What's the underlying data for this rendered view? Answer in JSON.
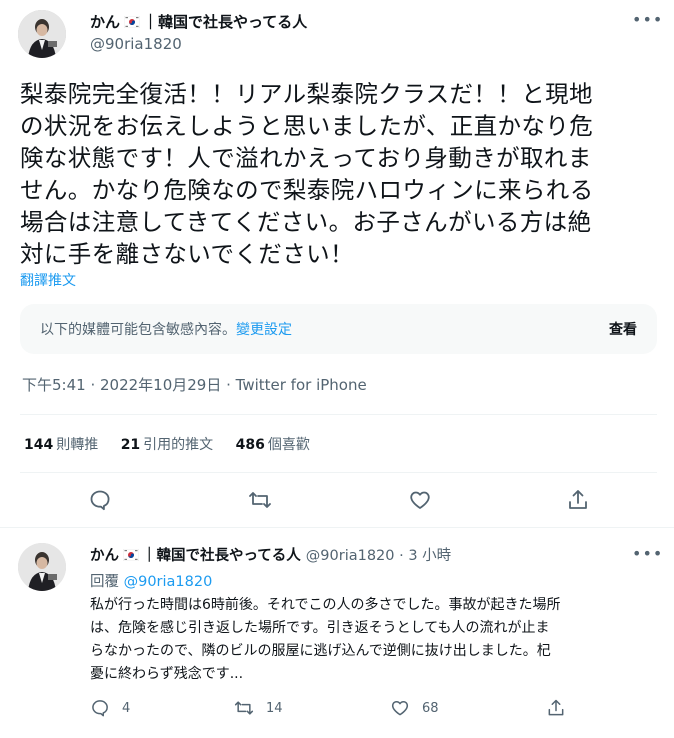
{
  "colors": {
    "accent": "#1d9bf0",
    "text": "#0f1419",
    "muted": "#536471",
    "box": "#f7f9f9",
    "border": "#eff3f4"
  },
  "main": {
    "display_name": "かん",
    "flag_icon": "korea-flag-icon",
    "name_suffix": "｜韓国で社長やってる人",
    "handle": "@90ria1820",
    "text_lines": [
      "梨泰院完全復活！！リアル梨泰院クラスだ！！と現地",
      "の状況をお伝えしようと思いましたが、正直かなり危",
      "険な状態です！人で溢れかえっており身動きが取れま",
      "せん。かなり危険なので梨泰院ハロウィンに来られる",
      "場合は注意してきてください。お子さんがいる方は絶",
      "対に手を離さないでください！"
    ],
    "translate_label": "翻譯推文",
    "sensitive": {
      "text": "以下的媒體可能包含敏感內容。",
      "link": "變更設定",
      "view": "查看"
    },
    "meta": "下午5:41 · 2022年10月29日 · Twitter for iPhone",
    "stats": [
      {
        "count": "144",
        "label": "則轉推"
      },
      {
        "count": "21",
        "label": "引用的推文"
      },
      {
        "count": "486",
        "label": "個喜歡"
      }
    ],
    "actions": [
      "reply-icon",
      "retweet-icon",
      "like-icon",
      "share-icon"
    ]
  },
  "reply": {
    "display_name": "かん",
    "name_suffix": "｜韓国で社長やってる人",
    "handle_time": "@90ria1820 · 3 小時",
    "replying_label": "回覆",
    "replying_to": "@90ria1820",
    "text_lines": [
      "私が行った時間は6時前後。それでこの人の多さでした。事故が起きた場所",
      "は、危険を感じ引き返した場所です。引き返そうとしても人の流れが止ま",
      "らなかったので、隣のビルの服屋に逃げ込んで逆側に抜け出しました。杞",
      "憂に終わらず残念です..."
    ],
    "reply_count": "4",
    "retweet_count": "14",
    "like_count": "68"
  }
}
